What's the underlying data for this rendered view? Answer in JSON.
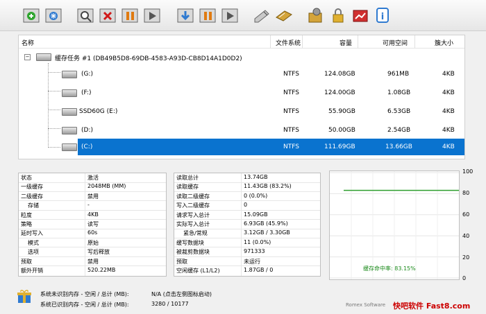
{
  "colors": {
    "selection": "#0a73cf",
    "graph_line": "#2e9e2e",
    "hit_label": "#1a8a1a"
  },
  "toolbar_icons": [
    "new-cache-icon",
    "snowflake-icon",
    "search-icon",
    "delete-icon",
    "pause-icon",
    "play-icon",
    "download-icon",
    "pause-all-icon",
    "resume-all-icon",
    "edit-icon",
    "tool-icon",
    "settings-icon",
    "lock-icon",
    "graph-icon",
    "info-icon"
  ],
  "list": {
    "headers": {
      "name": "名称",
      "fs": "文件系统",
      "capacity": "容量",
      "free": "可用空间",
      "cluster": "簇大小"
    },
    "task": "缓存任务 #1 (DB49B5D8-69DB-4583-A93D-CB8D14A1D0D2)",
    "rows": [
      {
        "name": "(G:)",
        "fs": "NTFS",
        "capacity": "124.08GB",
        "free": "961MB",
        "cluster": "4KB"
      },
      {
        "name": "(F:)",
        "fs": "NTFS",
        "capacity": "124.00GB",
        "free": "1.08GB",
        "cluster": "4KB"
      },
      {
        "name": "SSD60G (E:)",
        "fs": "NTFS",
        "capacity": "55.90GB",
        "free": "6.53GB",
        "cluster": "4KB"
      },
      {
        "name": "(D:)",
        "fs": "NTFS",
        "capacity": "50.00GB",
        "free": "2.54GB",
        "cluster": "4KB"
      },
      {
        "name": "(C:)",
        "fs": "NTFS",
        "capacity": "111.69GB",
        "free": "13.66GB",
        "cluster": "4KB"
      }
    ]
  },
  "left_panel": [
    {
      "k": "状态",
      "v": "激活"
    },
    {
      "k": "一级缓存",
      "v": "2048MB (MM)"
    },
    {
      "k": "二级缓存",
      "v": "禁用"
    },
    {
      "k": "存储",
      "v": "-"
    },
    {
      "k": "粒度",
      "v": "4KB"
    },
    {
      "k": "策略",
      "v": "读写"
    },
    {
      "k": "延时写入",
      "v": "60s"
    },
    {
      "k": "模式",
      "v": "原始"
    },
    {
      "k": "选项",
      "v": "写后释放"
    },
    {
      "k": "预取",
      "v": "禁用"
    },
    {
      "k": "额外开销",
      "v": "520.22MB"
    }
  ],
  "mid_panel": [
    {
      "k": "读取总计",
      "v": "13.74GB"
    },
    {
      "k": "读取缓存",
      "v": "11.43GB (83.2%)"
    },
    {
      "k": "读取二级缓存",
      "v": "0 (0.0%)"
    },
    {
      "k": "写入二级缓存",
      "v": "0"
    },
    {
      "k": "请求写入总计",
      "v": "15.09GB"
    },
    {
      "k": "实际写入总计",
      "v": "6.93GB (45.9%)"
    },
    {
      "k": "紧急/常规",
      "v": "3.12GB / 3.30GB"
    },
    {
      "k": "缓写数据块",
      "v": "11 (0.0%)"
    },
    {
      "k": "被裁剪数据块",
      "v": "971333"
    },
    {
      "k": "预取",
      "v": "未运行"
    },
    {
      "k": "空闲缓存 (L1/L2)",
      "v": "1.87GB / 0"
    }
  ],
  "graph": {
    "y_ticks": [
      "100",
      "80",
      "60",
      "40",
      "20",
      "0"
    ],
    "hit_label": "缓存命中率: 83.15%",
    "hit_rate": 83.15
  },
  "bottom": {
    "line1_label": "系统未识别内存 - 空闲 / 总计 (MB):",
    "line1_value": "N/A (点击左侧图标启动)",
    "line2_label": "系统已识别内存 - 空闲 / 总计 (MB):",
    "line2_value": "3280 / 10177",
    "vendor": "Romex Software",
    "watermark": "快吧软件 Fast8.com"
  }
}
